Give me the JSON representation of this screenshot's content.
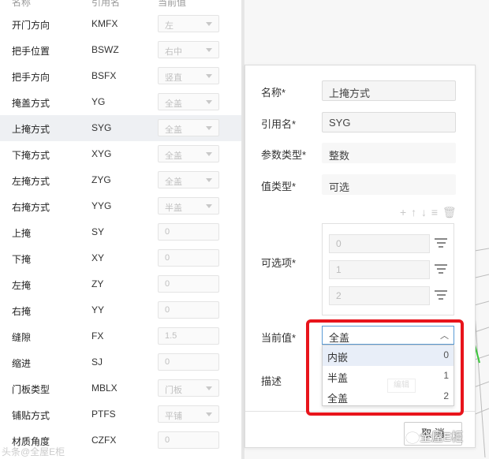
{
  "list": {
    "header": {
      "name": "名称",
      "ref": "引用名",
      "value": "当前值"
    },
    "rows": [
      {
        "name": "开门方向",
        "ref": "KMFX",
        "value": "左",
        "dropdown": true
      },
      {
        "name": "把手位置",
        "ref": "BSWZ",
        "value": "右中",
        "dropdown": true
      },
      {
        "name": "把手方向",
        "ref": "BSFX",
        "value": "竖直",
        "dropdown": true
      },
      {
        "name": "掩盖方式",
        "ref": "YG",
        "value": "全盖",
        "dropdown": true
      },
      {
        "name": "上掩方式",
        "ref": "SYG",
        "value": "全盖",
        "dropdown": true
      },
      {
        "name": "下掩方式",
        "ref": "XYG",
        "value": "全盖",
        "dropdown": true
      },
      {
        "name": "左掩方式",
        "ref": "ZYG",
        "value": "全盖",
        "dropdown": true
      },
      {
        "name": "右掩方式",
        "ref": "YYG",
        "value": "半盖",
        "dropdown": true
      },
      {
        "name": "上掩",
        "ref": "SY",
        "value": "0",
        "dropdown": false
      },
      {
        "name": "下掩",
        "ref": "XY",
        "value": "0",
        "dropdown": false
      },
      {
        "name": "左掩",
        "ref": "ZY",
        "value": "0",
        "dropdown": false
      },
      {
        "name": "右掩",
        "ref": "YY",
        "value": "0",
        "dropdown": false
      },
      {
        "name": "缝隙",
        "ref": "FX",
        "value": "1.5",
        "dropdown": false
      },
      {
        "name": "缩进",
        "ref": "SJ",
        "value": "0",
        "dropdown": false
      },
      {
        "name": "门板类型",
        "ref": "MBLX",
        "value": "门板",
        "dropdown": true
      },
      {
        "name": "铺贴方式",
        "ref": "PTFS",
        "value": "平铺",
        "dropdown": true
      },
      {
        "name": "材质角度",
        "ref": "CZFX",
        "value": "0",
        "dropdown": false
      }
    ],
    "selected_index": 4
  },
  "form": {
    "name_label": "名称*",
    "name_value": "上掩方式",
    "ref_label": "引用名*",
    "ref_value": "SYG",
    "param_type_label": "参数类型*",
    "param_type_value": "整数",
    "value_type_label": "值类型*",
    "value_type_value": "可选",
    "toolbar_icons": "+ ↑ ↓ ≡ 🗑",
    "options_label": "可选项*",
    "options": [
      "0",
      "1",
      "2"
    ],
    "current_label": "当前值*",
    "current_value": "全盖",
    "dropdown_items": [
      {
        "label": "内嵌",
        "value": "0"
      },
      {
        "label": "半盖",
        "value": "1"
      },
      {
        "label": "全盖",
        "value": "2"
      }
    ],
    "desc_label": "描述",
    "ghost_button": "编辑",
    "cancel_label": "取 消"
  },
  "watermark": {
    "left": "头条@全屋E柜",
    "right": "全屋E柜"
  },
  "colors": {
    "highlight": "#e8141b",
    "select_border": "#5a9bd5",
    "selected_row": "#eef0f3"
  }
}
